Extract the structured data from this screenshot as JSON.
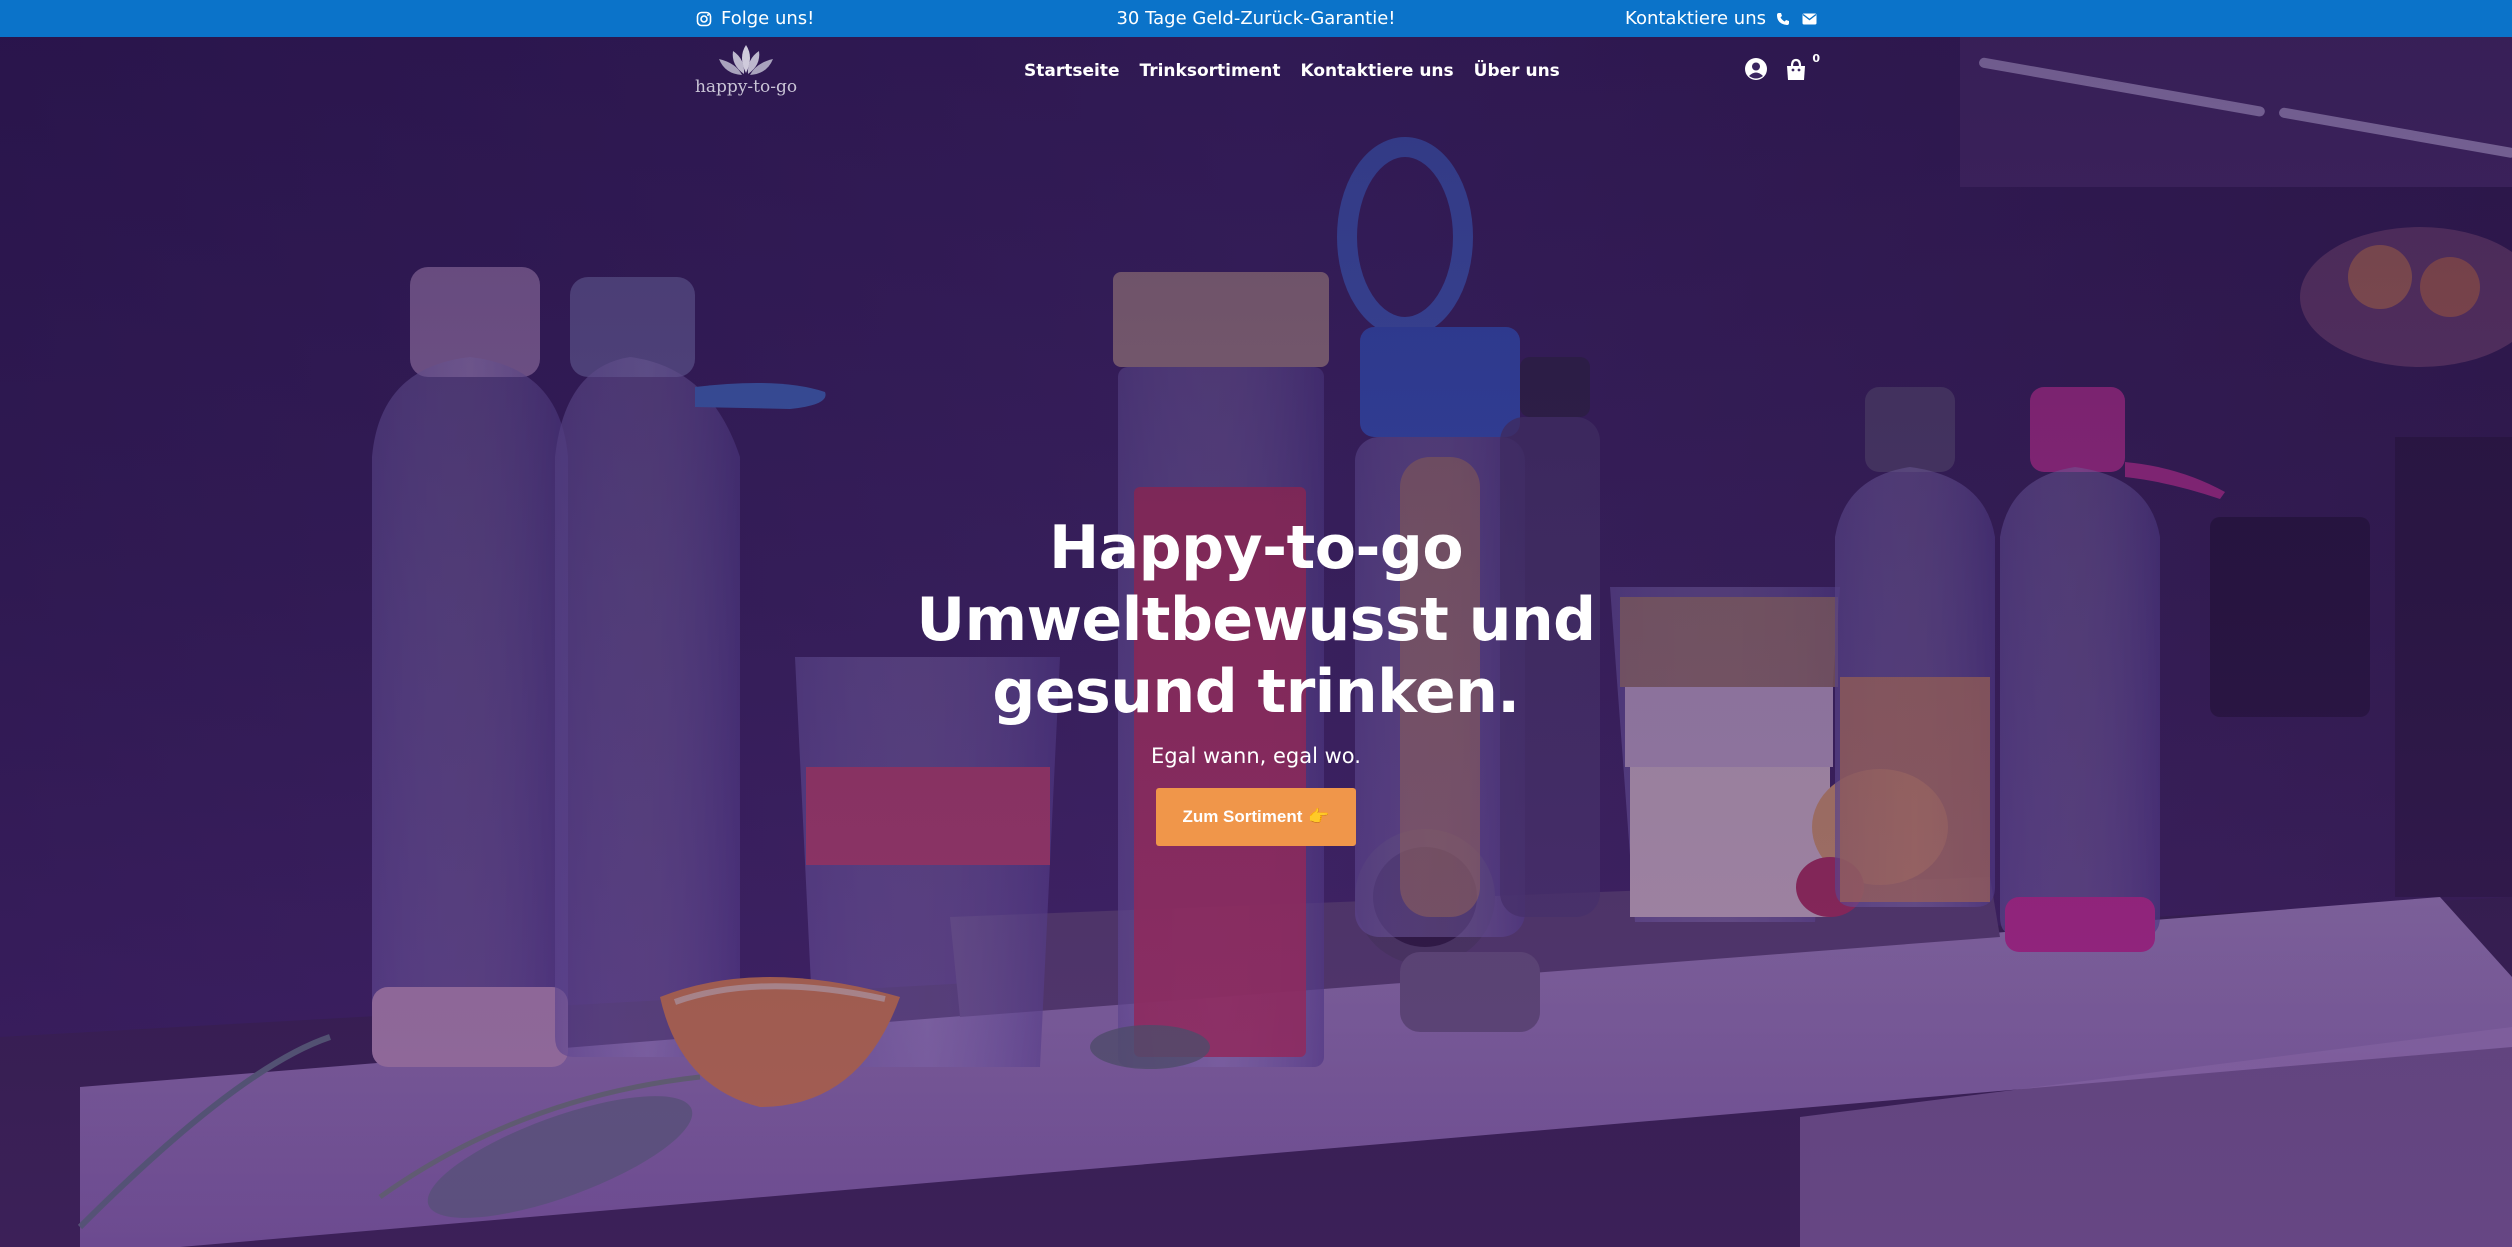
{
  "topbar": {
    "follow_label": "Folge uns!",
    "guarantee_text": "30 Tage Geld-Zurück-Garantie!",
    "contact_label": "Kontaktiere uns",
    "background": "#0b73c9"
  },
  "header": {
    "logo_text": "happy-to-go",
    "nav": [
      "Startseite",
      "Trinksortiment",
      "Kontaktiere uns",
      "Über uns"
    ],
    "cart_count": "0"
  },
  "hero": {
    "title_line1": "Happy-to-go",
    "title_line2": "Umweltbewusst und",
    "title_line3": "gesund trinken.",
    "subtitle": "Egal wann, egal wo.",
    "cta_label": "Zum Sortiment",
    "cta_emoji": "👉",
    "cta_color": "#f0964a"
  },
  "icons": [
    "instagram-icon",
    "phone-icon",
    "mail-icon",
    "account-icon",
    "shopping-bag-icon",
    "lotus-logo-icon",
    "pointing-hand-icon"
  ]
}
